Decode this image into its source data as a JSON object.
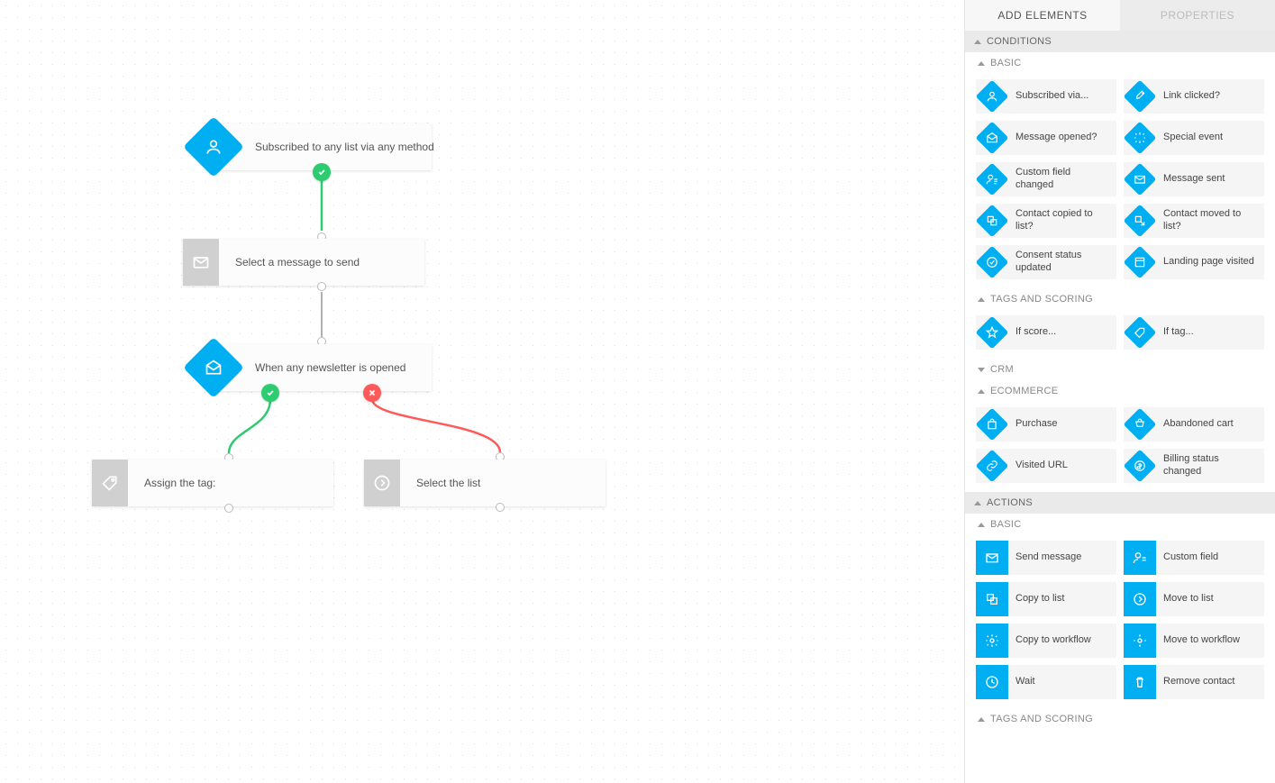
{
  "tabs": {
    "add": "ADD ELEMENTS",
    "props": "PROPERTIES"
  },
  "sections": {
    "conditions": "CONDITIONS",
    "actions": "ACTIONS",
    "basic": "BASIC",
    "tags_scoring": "TAGS AND SCORING",
    "crm": "CRM",
    "ecommerce": "ECOMMERCE"
  },
  "conditions": {
    "basic": [
      {
        "label": "Subscribed via..."
      },
      {
        "label": "Link clicked?"
      },
      {
        "label": "Message opened?"
      },
      {
        "label": "Special event"
      },
      {
        "label": "Custom field changed"
      },
      {
        "label": "Message sent"
      },
      {
        "label": "Contact copied to list?"
      },
      {
        "label": "Contact moved to list?"
      },
      {
        "label": "Consent status updated"
      },
      {
        "label": "Landing page visited"
      }
    ],
    "tags": [
      {
        "label": "If score..."
      },
      {
        "label": "If tag..."
      }
    ],
    "ecom": [
      {
        "label": "Purchase"
      },
      {
        "label": "Abandoned cart"
      },
      {
        "label": "Visited URL"
      },
      {
        "label": "Billing status changed"
      }
    ]
  },
  "actions": {
    "basic": [
      {
        "label": "Send message"
      },
      {
        "label": "Custom field"
      },
      {
        "label": "Copy to list"
      },
      {
        "label": "Move to list"
      },
      {
        "label": "Copy to workflow"
      },
      {
        "label": "Move to workflow"
      },
      {
        "label": "Wait"
      },
      {
        "label": "Remove contact"
      }
    ]
  },
  "canvas": {
    "subscribed": "Subscribed to any list via any method",
    "select_msg": "Select a message to send",
    "opened": "When any newsletter is opened",
    "assign_tag": "Assign the tag:",
    "select_list": "Select the list"
  }
}
